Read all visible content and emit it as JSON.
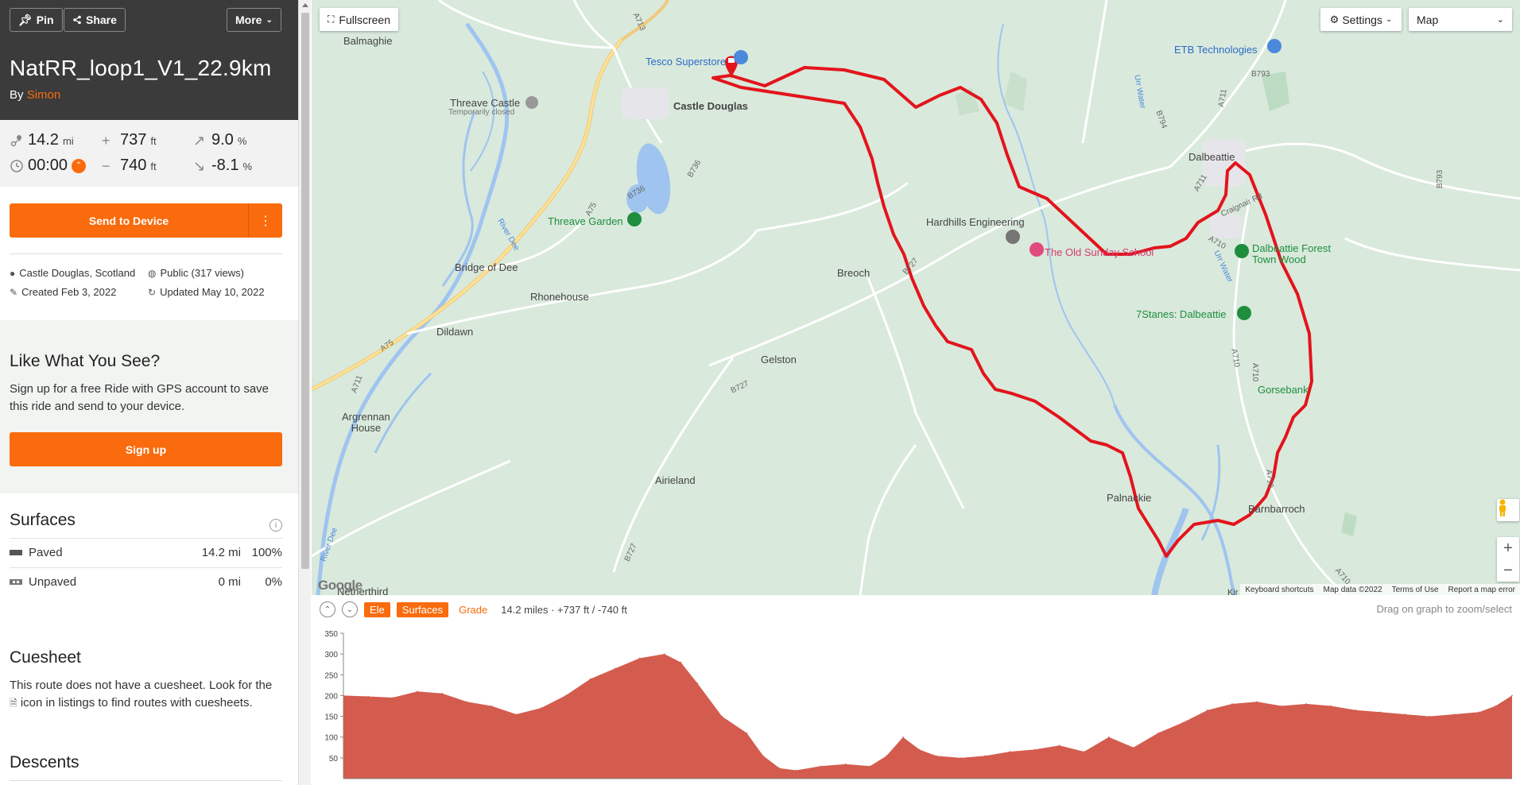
{
  "header": {
    "pin_label": "Pin",
    "share_label": "Share",
    "more_label": "More",
    "title": "NatRR_loop1_V1_22.9km",
    "by_prefix": "By",
    "author": "Simon"
  },
  "stats": {
    "distance": {
      "value": "14.2",
      "unit": "mi"
    },
    "elev_gain": {
      "value": "737",
      "unit": "ft"
    },
    "max_grade": {
      "value": "9.0",
      "unit": "%"
    },
    "duration": {
      "value": "00:00"
    },
    "elev_loss": {
      "value": "740",
      "unit": "ft"
    },
    "min_grade": {
      "value": "-8.1",
      "unit": "%"
    }
  },
  "actions": {
    "send_label": "Send to Device",
    "send_menu_icon": "vertical-ellipsis-icon"
  },
  "meta": {
    "location": "Castle Douglas, Scotland",
    "visibility": "Public (317 views)",
    "created": "Created Feb 3, 2022",
    "updated": "Updated May 10, 2022"
  },
  "promo": {
    "title": "Like What You See?",
    "text": "Sign up for a free Ride with GPS account to save this ride and send to your device.",
    "signup_label": "Sign up"
  },
  "surfaces": {
    "title": "Surfaces",
    "rows": [
      {
        "name": "Paved",
        "distance": "14.2 mi",
        "percent": "100%",
        "color": "#555555"
      },
      {
        "name": "Unpaved",
        "distance": "0 mi",
        "percent": "0%",
        "color": "#888888"
      }
    ]
  },
  "cuesheet": {
    "title": "Cuesheet",
    "text_before": "This route does not have a cuesheet. Look for the",
    "text_after": "icon in listings to find routes with cuesheets."
  },
  "descents": {
    "title": "Descents"
  },
  "map": {
    "fullscreen_label": "Fullscreen",
    "settings_label": "Settings",
    "map_type": "Map",
    "labels": {
      "balmaghie": "Balmaghie",
      "tesco": "Tesco Superstore",
      "castle_douglas": "Castle Douglas",
      "threave_castle": "Threave Castle",
      "temp_closed": "Temporarily closed",
      "threave_garden": "Threave Garden",
      "bridge_of_dee": "Bridge of Dee",
      "rhonehouse": "Rhonehouse",
      "dildawn": "Dildawn",
      "breoch": "Breoch",
      "gelston": "Gelston",
      "argrennan": "Argrennan\nHouse",
      "airieland": "Airieland",
      "netherthird": "Netherthird",
      "hardhills": "Hardhills Engineering",
      "old_sunday_school": "The Old Sunday School",
      "etb": "ETB Technologies",
      "dalbeattie": "Dalbeattie",
      "dalbeattie_forest": "Dalbeattie Forest\nTown Wood",
      "sevenstanes": "7Stanes: Dalbeattie",
      "gorsebank": "Gorsebank",
      "palnackie": "Palnackie",
      "barnbarroch": "Barnbarroch",
      "kir": "Kir",
      "river_dee": "River Dee",
      "urr_water": "Urr Water"
    },
    "road_labels": {
      "a713": "A713",
      "a75": "A75",
      "b736": "B736",
      "a711": "A711",
      "b727": "B727",
      "b794": "B794",
      "b793": "B793",
      "a710": "A710",
      "craignair": "Craignair Rd"
    },
    "attribution": {
      "shortcuts": "Keyboard shortcuts",
      "data": "Map data ©2022",
      "terms": "Terms of Use",
      "report": "Report a map error"
    },
    "google": "Google",
    "route_color": "#e3141c"
  },
  "elevation": {
    "tab_ele": "Ele",
    "tab_surfaces": "Surfaces",
    "tab_grade": "Grade",
    "summary": "14.2 miles · +737 ft / -740 ft",
    "hint": "Drag on graph to zoom/select",
    "fill_color": "#d35c4f"
  },
  "chart_data": {
    "type": "area",
    "xlabel": "",
    "ylabel": "",
    "ylim": [
      0,
      350
    ],
    "yticks": [
      50,
      100,
      150,
      200,
      250,
      300,
      350
    ],
    "xlim": [
      0,
      14.2
    ],
    "x": [
      0,
      0.3,
      0.6,
      0.9,
      1.2,
      1.5,
      1.8,
      2.1,
      2.4,
      2.7,
      3.0,
      3.3,
      3.6,
      3.9,
      4.1,
      4.3,
      4.6,
      4.9,
      5.1,
      5.3,
      5.5,
      5.8,
      6.1,
      6.4,
      6.6,
      6.8,
      7.0,
      7.2,
      7.5,
      7.8,
      8.1,
      8.4,
      8.7,
      9.0,
      9.3,
      9.6,
      9.9,
      10.2,
      10.5,
      10.8,
      11.1,
      11.4,
      11.7,
      12.0,
      12.3,
      12.6,
      12.9,
      13.2,
      13.5,
      13.8,
      14.0,
      14.2
    ],
    "values": [
      200,
      198,
      195,
      210,
      205,
      185,
      175,
      155,
      170,
      200,
      240,
      265,
      290,
      300,
      280,
      230,
      150,
      110,
      55,
      25,
      20,
      30,
      35,
      30,
      55,
      100,
      70,
      55,
      50,
      55,
      65,
      70,
      80,
      65,
      100,
      75,
      110,
      135,
      165,
      180,
      185,
      175,
      180,
      175,
      165,
      160,
      155,
      150,
      155,
      160,
      175,
      200
    ]
  }
}
